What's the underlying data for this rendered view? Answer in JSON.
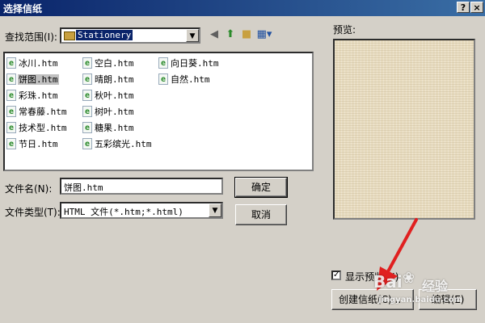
{
  "window": {
    "title": "选择信纸",
    "help_btn": "?",
    "close_btn": "×"
  },
  "lookin": {
    "label": "查找范围(I):",
    "value": "Stationery"
  },
  "toolbar": {
    "icons": [
      "back-icon",
      "up-folder-icon",
      "new-folder-icon",
      "view-menu-icon"
    ]
  },
  "files": [
    {
      "name": "冰川.htm"
    },
    {
      "name": "饼图.htm",
      "selected": true
    },
    {
      "name": "彩珠.htm"
    },
    {
      "name": "常春藤.htm"
    },
    {
      "name": "技术型.htm"
    },
    {
      "name": "节日.htm"
    },
    {
      "name": "空白.htm"
    },
    {
      "name": "晴朗.htm"
    },
    {
      "name": "秋叶.htm"
    },
    {
      "name": "树叶.htm"
    },
    {
      "name": "糖果.htm"
    },
    {
      "name": "五彩缤光.htm"
    },
    {
      "name": "向日葵.htm"
    },
    {
      "name": "自然.htm"
    }
  ],
  "filename": {
    "label": "文件名(N):",
    "value": "饼图.htm"
  },
  "filetype": {
    "label": "文件类型(T):",
    "value": "HTML 文件(*.htm;*.html)"
  },
  "buttons": {
    "ok": "确定",
    "cancel": "取消",
    "create": "创建信纸(C)...",
    "edit": "编辑(E)"
  },
  "preview": {
    "label": "预览:"
  },
  "show_preview": {
    "label": "显示预览(H)",
    "checked": true
  },
  "watermark": {
    "brand": "Bai",
    "brand2": "经验",
    "url": "jingyan.baidu.com"
  },
  "colors": {
    "titlebar": "#0a246a",
    "arrow": "#e02020",
    "paper": "#e8dcc0"
  }
}
